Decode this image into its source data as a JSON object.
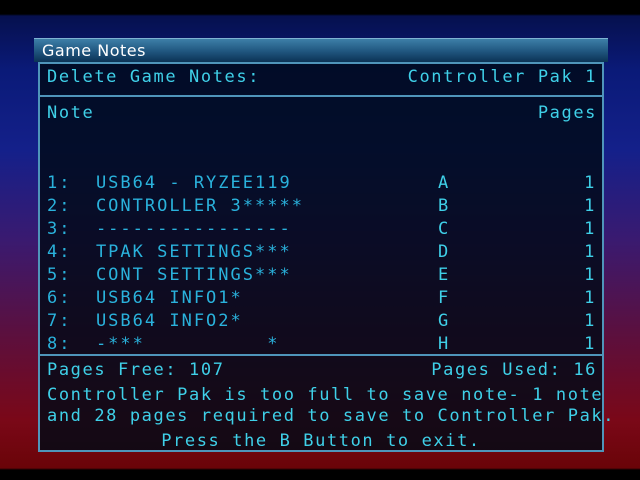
{
  "window": {
    "title": "Game Notes"
  },
  "header": {
    "action_label": "Delete Game Notes:",
    "device_label": "Controller Pak 1"
  },
  "columns": {
    "note": "Note",
    "pages": "Pages"
  },
  "notes": [
    {
      "name": "1:  USB64 - RYZEE119",
      "letter": "A",
      "pages": "1"
    },
    {
      "name": "2:  CONTROLLER 3*****",
      "letter": "B",
      "pages": "1"
    },
    {
      "name": "3:  ----------------",
      "letter": "C",
      "pages": "1"
    },
    {
      "name": "4:  TPAK SETTINGS***",
      "letter": "D",
      "pages": "1"
    },
    {
      "name": "5:  CONT SETTINGS***",
      "letter": "E",
      "pages": "1"
    },
    {
      "name": "6:  USB64 INFO1*",
      "letter": "F",
      "pages": "1"
    },
    {
      "name": "7:  USB64 INFO2*",
      "letter": "G",
      "pages": "1"
    },
    {
      "name": "8:  -***          *",
      "letter": "H",
      "pages": "1"
    }
  ],
  "footer": {
    "pages_free": "Pages Free: 107",
    "pages_used": "Pages Used: 16",
    "message_line1": "Controller Pak is too full to save note- 1 note",
    "message_line2": "and 28 pages required to save to Controller Pak.",
    "exit_prompt": "Press the B Button to exit."
  },
  "colors": {
    "text": "#3fd0e8",
    "border": "#4f95ba",
    "title_bar": "#2a6690"
  }
}
